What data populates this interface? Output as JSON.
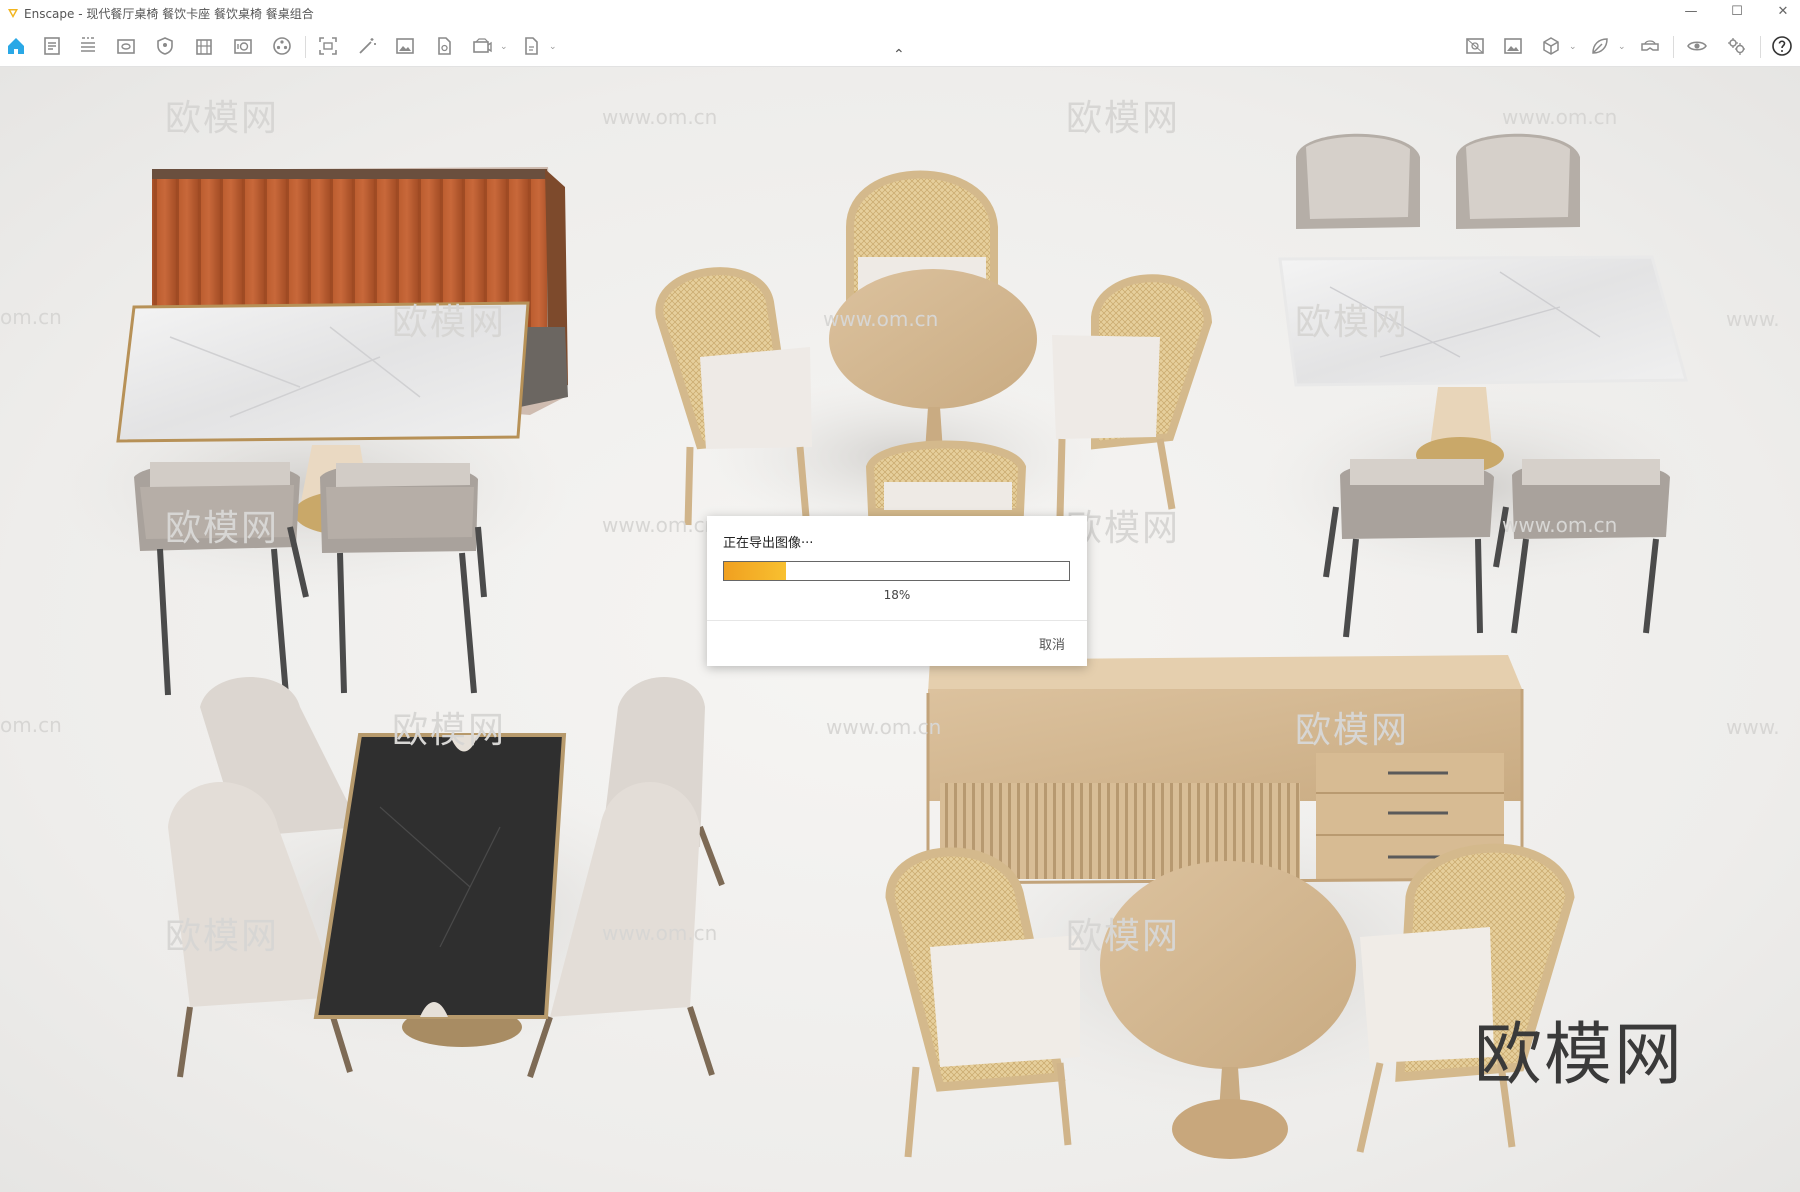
{
  "window": {
    "title": "Enscape - 现代餐厅桌椅 餐饮卡座 餐饮桌椅 餐桌组合",
    "minimize_glyph": "—",
    "maximize_glyph": "☐",
    "close_glyph": "✕"
  },
  "watermarks": {
    "brand": "欧模网",
    "url": "www.om.cn",
    "url_fragment_left": "om.cn",
    "url_fragment_right": "www."
  },
  "export_dialog": {
    "message": "正在导出图像···",
    "progress": 0.18,
    "percent_label": "18%",
    "cancel_label": "取消"
  },
  "colors": {
    "accent": "#2aa8e6",
    "progress_fill": "#f4b02a",
    "toolbar_icon": "#8a8a8a"
  }
}
